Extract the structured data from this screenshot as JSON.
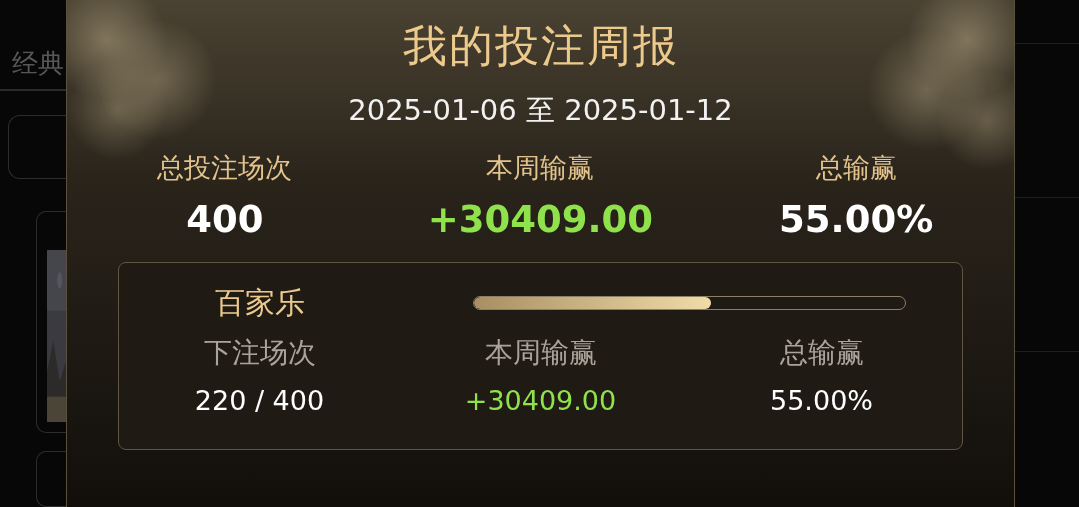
{
  "background": {
    "tab": "经典"
  },
  "dialog": {
    "title": "我的投注周报",
    "date_range": "2025-01-06 至 2025-01-12",
    "summary": [
      {
        "label": "总投注场次",
        "value": "400",
        "kind": "plain"
      },
      {
        "label": "本周输赢",
        "value": "+30409.00",
        "kind": "gain"
      },
      {
        "label": "总输赢",
        "value": "55.00%",
        "kind": "plain"
      }
    ],
    "games": [
      {
        "name": "百家乐",
        "level": 0.55,
        "stats": [
          {
            "label": "下注场次",
            "value": "220 / 400",
            "kind": "plain"
          },
          {
            "label": "本周输赢",
            "value": "+30409.00",
            "kind": "gain"
          },
          {
            "label": "总输赢",
            "value": "55.00%",
            "kind": "plain"
          }
        ]
      }
    ]
  }
}
